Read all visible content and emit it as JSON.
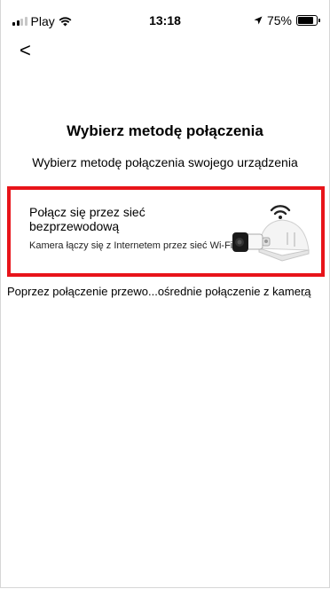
{
  "status_bar": {
    "carrier": "Play",
    "time": "13:18",
    "battery": "75%",
    "battery_level": 0.75
  },
  "header": {
    "back_glyph": "<",
    "back_icon": "chevron-left-icon"
  },
  "main": {
    "title": "Wybierz metodę połączenia",
    "subtitle": "Wybierz metodę połączenia swojego urządzenia",
    "wireless_option": {
      "title": "Połącz się przez sieć bezprzewodową",
      "description": "Kamera łączy się z Internetem przez sieć Wi-Fi",
      "highlight_color": "#e8141a"
    },
    "wired_option": {
      "label": "Poprzez połączenie przewo...ośrednie połączenie z kamerą",
      "chevron_icon": "chevron-down-icon"
    }
  }
}
